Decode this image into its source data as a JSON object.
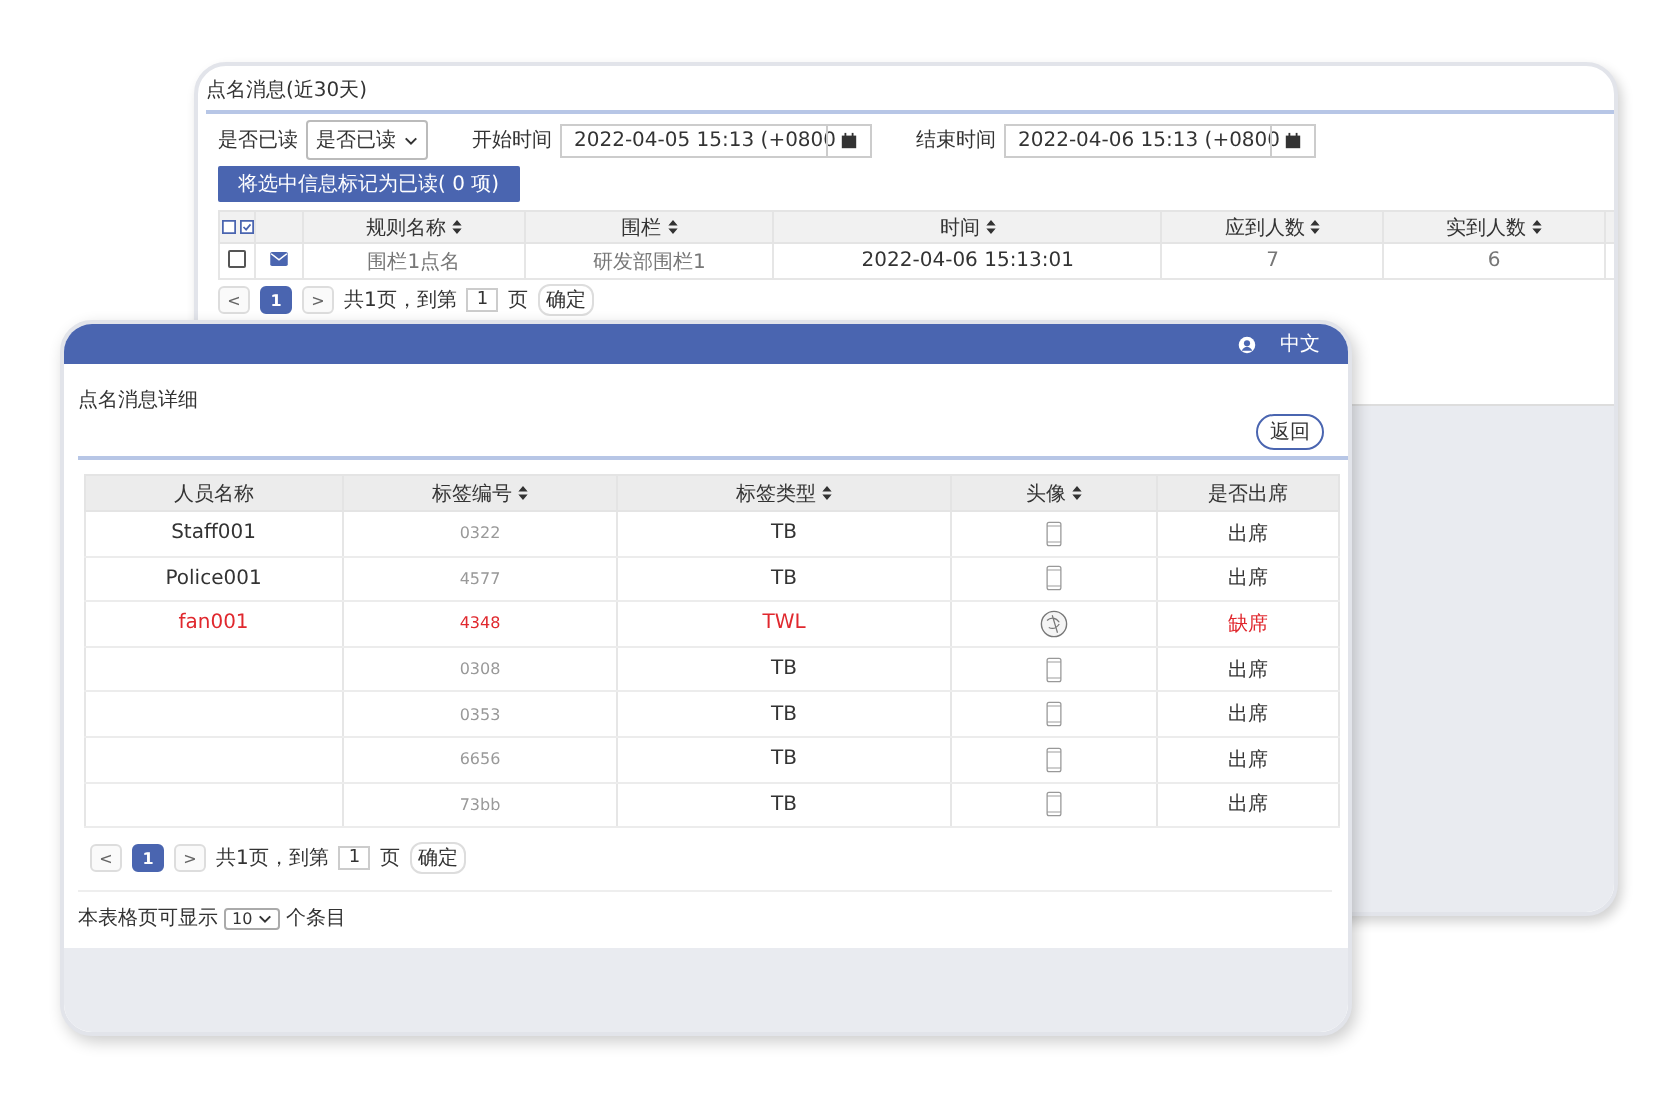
{
  "back_window": {
    "title": "点名消息(近30天)",
    "read_filter": {
      "label": "是否已读",
      "value": "是否已读"
    },
    "start_time": {
      "label": "开始时间",
      "value": "2022-04-05 15:13 (+0800"
    },
    "end_time": {
      "label": "结束时间",
      "value": "2022-04-06 15:13 (+0800"
    },
    "mark_button": "将选中信息标记为已读( 0 项)",
    "table": {
      "columns": [
        {
          "label": "规则名称",
          "sortable": true
        },
        {
          "label": "围栏",
          "sortable": true
        },
        {
          "label": "时间",
          "sortable": true
        },
        {
          "label": "应到人数",
          "sortable": true
        },
        {
          "label": "实到人数",
          "sortable": true
        }
      ],
      "rows": [
        {
          "checked": false,
          "unread": true,
          "cells": [
            "围栏1点名",
            "研发部围栏1",
            "2022-04-06 15:13:01",
            "7",
            "6"
          ]
        }
      ]
    },
    "pagination": {
      "prev": "<",
      "pages": [
        {
          "label": "1",
          "selected": true
        }
      ],
      "next": ">",
      "total": "共1页，到第",
      "page_input": "1",
      "page_unit": "页",
      "confirm": "确定"
    }
  },
  "front_window": {
    "language": "中文",
    "title": "点名消息详细",
    "back_button": "返回",
    "table": {
      "columns": [
        {
          "label": "人员名称",
          "sortable": false
        },
        {
          "label": "标签编号",
          "sortable": true
        },
        {
          "label": "标签类型",
          "sortable": true
        },
        {
          "label": "头像",
          "sortable": true
        },
        {
          "label": "是否出席",
          "sortable": false
        }
      ],
      "rows": [
        {
          "name": "Staff001",
          "tag": "0322",
          "type": "TB",
          "avatar": {
            "kind": "phone"
          },
          "status": "出席",
          "absent": false
        },
        {
          "name": "Police001",
          "tag": "4577",
          "type": "TB",
          "avatar": {
            "kind": "phone"
          },
          "status": "出席",
          "absent": false
        },
        {
          "name": "fan001",
          "tag": "4348",
          "type": "TWL",
          "avatar": {
            "kind": "coin"
          },
          "status": "缺席",
          "absent": true
        },
        {
          "name": "",
          "tag": "0308",
          "type": "TB",
          "avatar": {
            "kind": "phone"
          },
          "status": "出席",
          "absent": false
        },
        {
          "name": "",
          "tag": "0353",
          "type": "TB",
          "avatar": {
            "kind": "phone"
          },
          "status": "出席",
          "absent": false
        },
        {
          "name": "",
          "tag": "6656",
          "type": "TB",
          "avatar": {
            "kind": "phone"
          },
          "status": "出席",
          "absent": false
        },
        {
          "name": "",
          "tag": "73bb",
          "type": "TB",
          "avatar": {
            "kind": "phone"
          },
          "status": "出席",
          "absent": false
        }
      ]
    },
    "pagination": {
      "prev": "<",
      "pages": [
        {
          "label": "1",
          "selected": true
        }
      ],
      "next": ">",
      "total": "共1页，到第",
      "page_input": "1",
      "page_unit": "页",
      "confirm": "确定"
    },
    "page_size": {
      "prefix": "本表格页可显示",
      "value": "10",
      "suffix": "个条目"
    }
  }
}
